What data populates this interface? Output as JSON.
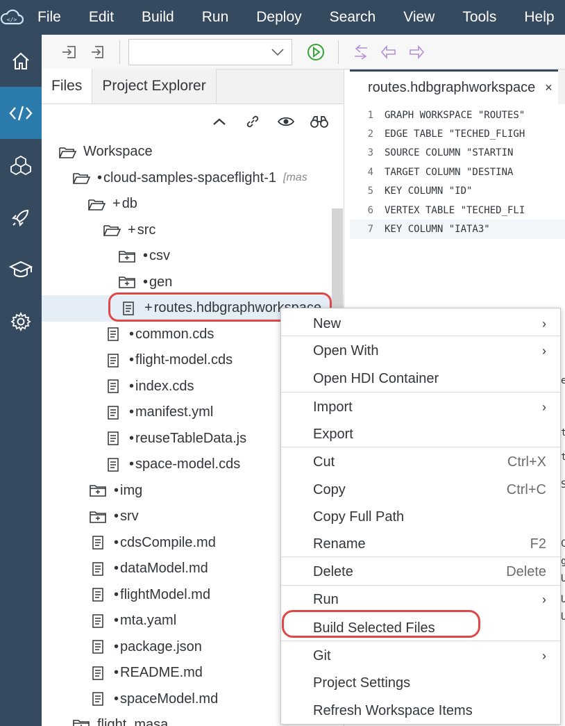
{
  "menubar": {
    "items": [
      "File",
      "Edit",
      "Build",
      "Run",
      "Deploy",
      "Search",
      "View",
      "Tools",
      "Help"
    ]
  },
  "panel": {
    "tabs": [
      "Files",
      "Project Explorer"
    ]
  },
  "tree": [
    {
      "prefix": "",
      "label": "Workspace",
      "icon": "folder-open-icon",
      "branch": ""
    },
    {
      "prefix": "•",
      "label": "cloud-samples-spaceflight-1",
      "icon": "folder-open-icon",
      "branch": "[mas"
    },
    {
      "prefix": "+",
      "label": "db",
      "icon": "folder-open-icon",
      "branch": ""
    },
    {
      "prefix": "+",
      "label": "src",
      "icon": "folder-open-icon",
      "branch": ""
    },
    {
      "prefix": "•",
      "label": "csv",
      "icon": "folder-closed-icon",
      "branch": ""
    },
    {
      "prefix": "•",
      "label": "gen",
      "icon": "folder-closed-icon",
      "branch": ""
    },
    {
      "prefix": "+",
      "label": "routes.hdbgraphworkspace",
      "icon": "file-icon",
      "branch": ""
    },
    {
      "prefix": "•",
      "label": "common.cds",
      "icon": "file-icon",
      "branch": ""
    },
    {
      "prefix": "•",
      "label": "flight-model.cds",
      "icon": "file-icon",
      "branch": ""
    },
    {
      "prefix": "•",
      "label": "index.cds",
      "icon": "file-icon",
      "branch": ""
    },
    {
      "prefix": "•",
      "label": "manifest.yml",
      "icon": "file-icon",
      "branch": ""
    },
    {
      "prefix": "•",
      "label": "reuseTableData.js",
      "icon": "file-icon",
      "branch": ""
    },
    {
      "prefix": "•",
      "label": "space-model.cds",
      "icon": "file-icon",
      "branch": ""
    },
    {
      "prefix": "•",
      "label": "img",
      "icon": "folder-closed-icon",
      "branch": ""
    },
    {
      "prefix": "•",
      "label": "srv",
      "icon": "folder-closed-icon",
      "branch": ""
    },
    {
      "prefix": "•",
      "label": "cdsCompile.md",
      "icon": "file-icon",
      "branch": ""
    },
    {
      "prefix": "•",
      "label": "dataModel.md",
      "icon": "file-icon",
      "branch": ""
    },
    {
      "prefix": "•",
      "label": "flightModel.md",
      "icon": "file-icon",
      "branch": ""
    },
    {
      "prefix": "•",
      "label": "mta.yaml",
      "icon": "file-icon",
      "branch": ""
    },
    {
      "prefix": "•",
      "label": "package.json",
      "icon": "file-icon",
      "branch": ""
    },
    {
      "prefix": "•",
      "label": "README.md",
      "icon": "file-icon",
      "branch": ""
    },
    {
      "prefix": "•",
      "label": "spaceModel.md",
      "icon": "file-icon",
      "branch": ""
    },
    {
      "prefix": "",
      "label": "flight_masa",
      "icon": "folder-closed-icon",
      "branch": ""
    }
  ],
  "editor": {
    "tab_label": "routes.hdbgraphworkspace",
    "close_glyph": "×",
    "lines": [
      {
        "n": "1",
        "text": "GRAPH WORKSPACE \"ROUTES\""
      },
      {
        "n": "2",
        "text": "EDGE TABLE \"TECHED_FLIGH"
      },
      {
        "n": "3",
        "text": "  SOURCE COLUMN \"STARTIN"
      },
      {
        "n": "4",
        "text": "  TARGET COLUMN \"DESTINA"
      },
      {
        "n": "5",
        "text": "  KEY COLUMN \"ID\""
      },
      {
        "n": "6",
        "text": "VERTEX TABLE \"TECHED_FLI"
      },
      {
        "n": "7",
        "text": "  KEY COLUMN \"IATA3\""
      }
    ],
    "partial": [
      "e",
      "t",
      "t",
      "S)",
      "C",
      "g",
      "U",
      "U",
      "U"
    ]
  },
  "context_menu": {
    "items": [
      {
        "label": "New",
        "shortcut": "",
        "submenu": true
      },
      {
        "label": "Open With",
        "shortcut": "",
        "submenu": true
      },
      {
        "label": "Open HDI Container",
        "shortcut": "",
        "submenu": false
      },
      {
        "label": "Import",
        "shortcut": "",
        "submenu": true
      },
      {
        "label": "Export",
        "shortcut": "",
        "submenu": false
      },
      {
        "label": "Cut",
        "shortcut": "Ctrl+X",
        "submenu": false
      },
      {
        "label": "Copy",
        "shortcut": "Ctrl+C",
        "submenu": false
      },
      {
        "label": "Copy Full Path",
        "shortcut": "",
        "submenu": false
      },
      {
        "label": "Rename",
        "shortcut": "F2",
        "submenu": false
      },
      {
        "label": "Delete",
        "shortcut": "Delete",
        "submenu": false
      },
      {
        "label": "Run",
        "shortcut": "",
        "submenu": true
      },
      {
        "label": "Build Selected Files",
        "shortcut": "",
        "submenu": false
      },
      {
        "label": "Git",
        "shortcut": "",
        "submenu": true
      },
      {
        "label": "Project Settings",
        "shortcut": "",
        "submenu": false
      },
      {
        "label": "Refresh Workspace Items",
        "shortcut": "",
        "submenu": false
      }
    ],
    "submenu_glyph": "›"
  },
  "colors": {
    "shell": "#354a5f",
    "active_nav": "#2b7cad",
    "highlight_ring": "#e04848",
    "run_icon": "#35a335"
  }
}
